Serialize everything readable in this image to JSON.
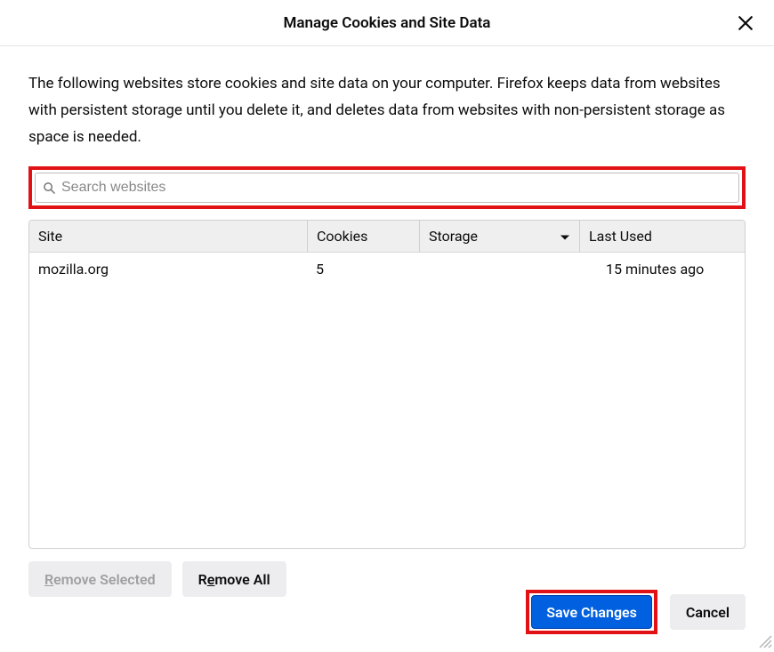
{
  "dialog": {
    "title": "Manage Cookies and Site Data",
    "description": "The following websites store cookies and site data on your computer. Firefox keeps data from websites with persistent storage until you delete it, and deletes data from websites with non-persistent storage as space is needed."
  },
  "search": {
    "placeholder": "Search websites"
  },
  "table": {
    "headers": {
      "site": "Site",
      "cookies": "Cookies",
      "storage": "Storage",
      "last_used": "Last Used"
    },
    "rows": [
      {
        "site": "mozilla.org",
        "cookies": "5",
        "storage": "",
        "last_used": "15 minutes ago"
      }
    ]
  },
  "buttons": {
    "remove_selected_pre": "R",
    "remove_selected_post": "emove Selected",
    "remove_all_pre": "R",
    "remove_all_post": "emove All",
    "save_changes": "Save Changes",
    "cancel": "Cancel"
  }
}
